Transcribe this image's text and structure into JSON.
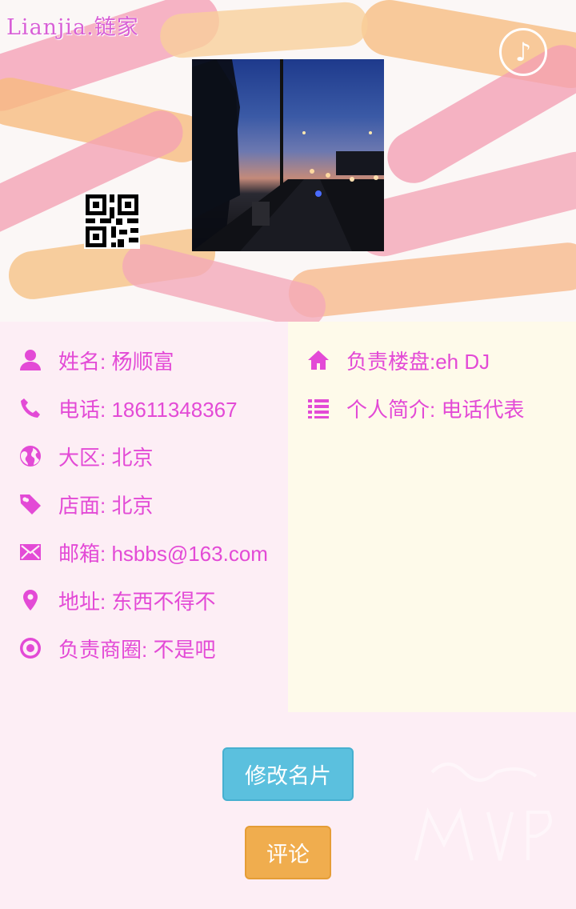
{
  "header": {
    "brand": "Lianjia.链家",
    "music_icon": "music-note-icon",
    "qr_icon": "qr-code-icon"
  },
  "profile": {
    "left": [
      {
        "icon": "user-icon",
        "text": "姓名: 杨顺富"
      },
      {
        "icon": "phone-icon",
        "text": "电话: 18611348367"
      },
      {
        "icon": "globe-icon",
        "text": "大区: 北京"
      },
      {
        "icon": "tag-icon",
        "text": "店面: 北京"
      },
      {
        "icon": "envelope-icon",
        "text": "邮箱: hsbbs@163.com"
      },
      {
        "icon": "map-marker-icon",
        "text": "地址: 东西不得不"
      },
      {
        "icon": "target-icon",
        "text": "负责商圈: 不是吧"
      }
    ],
    "right": [
      {
        "icon": "home-icon",
        "text": "负责楼盘:eh DJ"
      },
      {
        "icon": "list-icon",
        "text": "个人简介: 电话代表"
      }
    ]
  },
  "actions": {
    "edit_label": "修改名片",
    "comment_label": "评论"
  },
  "colors": {
    "accent": "#e34ad6",
    "edit_button": "#5bc0de",
    "comment_button": "#f0ad4e",
    "left_panel": "#fdeef5",
    "right_panel": "#fefaea"
  }
}
